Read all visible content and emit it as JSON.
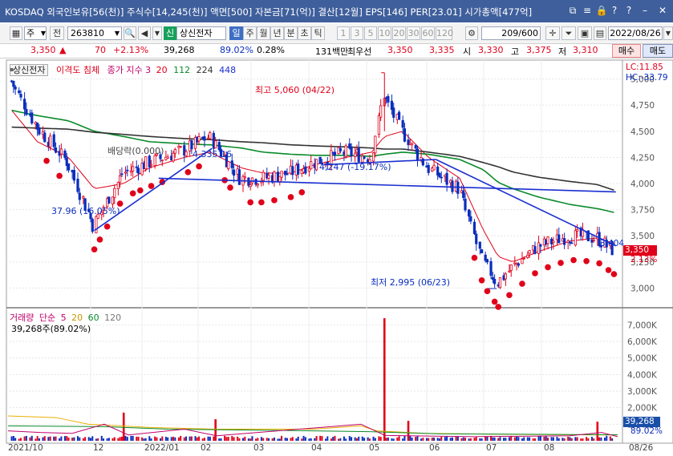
{
  "window": {
    "title": "KOSDAQ 외국인보유[56(천)] 주식수[14,245(천)] 액면[500] 자본금[71(억)] 결산[12월] EPS[146] PER[23.01] 시가총액[477억]",
    "icons": [
      "link-icon",
      "list-icon",
      "lock-icon",
      "help-icon",
      "minimize-icon",
      "close-icon"
    ]
  },
  "toolbar": {
    "market_option": "주",
    "previous_label": "전",
    "stock_code": "263810",
    "stock_name_prefix": "신",
    "stock_name": "상신전자",
    "periods": [
      "일",
      "주",
      "월",
      "년",
      "분",
      "초",
      "틱"
    ],
    "selected_period": "일",
    "minute_intervals": [
      "1",
      "3",
      "5",
      "10",
      "20",
      "30",
      "60",
      "120"
    ],
    "count": "209",
    "count_total": "/600",
    "date": "2022/08/26"
  },
  "quote": {
    "price": "3,350",
    "change": "70",
    "change_pct": "+2.13%",
    "volume": "39,268",
    "volume_ratio": "89.02%",
    "turnover": "0.28%",
    "trade_amount": "131백만",
    "priority_label": "최우선",
    "ask_price": "3,350",
    "bid_price": "3,335",
    "open_label": "시",
    "open": "3,330",
    "high_label": "고",
    "high": "3,375",
    "low_label": "저",
    "low": "3,310",
    "buy_label": "매수",
    "sell_label": "매도"
  },
  "price_legend": {
    "name": "상신전자",
    "indicator": "이격도 침체",
    "ma_label": "종가 지수 3",
    "ma1": "20",
    "ma2": "112",
    "ma3": "224",
    "ma4": "448"
  },
  "volume_legend": {
    "label": "거래량",
    "ma_label": "단순",
    "ma1": "5",
    "ma2": "20",
    "ma3": "60",
    "ma4": "120",
    "current": "39,268주(89.02%)"
  },
  "axis_tags": {
    "lc": "LC:11.85",
    "hc": "HC:-33.79",
    "price_tag": "3,350",
    "change_tag": "2.13%",
    "volume_tag": "39,268",
    "volume_pct_tag": "89.02%",
    "trend_tag": "3,404"
  },
  "annotations": {
    "high": "최고 5,060 (04/22)",
    "low": "최저 2,995 (06/23)",
    "left": "37.96 (16.05%)",
    "dividend": "배당락(0.000)",
    "trend1": "4,335.16",
    "trend2": "4,247 (-19.17%)"
  },
  "chart_data": [
    {
      "type": "line",
      "subtype": "candlestick",
      "title": "상신전자",
      "y_ticks": [
        "5,000",
        "4,750",
        "4,500",
        "4,250",
        "4,000",
        "3,750",
        "3,500",
        "3,250",
        "3,000"
      ],
      "ylim": [
        2850,
        5150
      ],
      "x_labels": [
        "2021/10",
        "12",
        "2022/01",
        "02",
        "03",
        "04",
        "05",
        "06",
        "07",
        "08",
        "08/26"
      ],
      "series": [
        {
          "name": "종가",
          "x": [
            "2021/10/01",
            "2021/10/15",
            "2021/11/01",
            "2021/11/15",
            "2021/12/01",
            "2021/12/15",
            "2022/01/03",
            "2022/01/17",
            "2022/02/03",
            "2022/02/15",
            "2022/03/02",
            "2022/03/15",
            "2022/04/01",
            "2022/04/15",
            "2022/04/22",
            "2022/05/02",
            "2022/05/16",
            "2022/06/02",
            "2022/06/15",
            "2022/06/23",
            "2022/07/01",
            "2022/07/15",
            "2022/08/01",
            "2022/08/16",
            "2022/08/26"
          ],
          "values": [
            4980,
            4550,
            4200,
            3600,
            4100,
            4200,
            4320,
            4450,
            4050,
            4050,
            4100,
            4200,
            4300,
            4250,
            4850,
            4500,
            4150,
            3950,
            3250,
            3050,
            3200,
            3400,
            3500,
            3480,
            3350
          ]
        },
        {
          "name": "MA 20",
          "values": [
            4700,
            4400,
            4250,
            3950,
            4000,
            4150,
            4250,
            4300,
            4150,
            4100,
            4100,
            4180,
            4250,
            4300,
            4450,
            4500,
            4250,
            4050,
            3550,
            3300,
            3250,
            3350,
            3450,
            3480,
            3420
          ]
        },
        {
          "name": "MA 112",
          "values": [
            4700,
            4650,
            4600,
            4500,
            4450,
            4400,
            4380,
            4370,
            4340,
            4300,
            4280,
            4270,
            4270,
            4260,
            4280,
            4300,
            4280,
            4230,
            4130,
            4010,
            3950,
            3870,
            3800,
            3760,
            3720
          ]
        },
        {
          "name": "MA 224",
          "values": [
            4540,
            4530,
            4520,
            4490,
            4470,
            4450,
            4430,
            4420,
            4400,
            4390,
            4370,
            4360,
            4350,
            4340,
            4330,
            4330,
            4300,
            4260,
            4200,
            4160,
            4110,
            4060,
            4020,
            3990,
            3930
          ]
        }
      ]
    },
    {
      "type": "bar",
      "title": "거래량",
      "y_ticks": [
        "7,000K",
        "6,000K",
        "5,000K",
        "4,000K",
        "3,000K",
        "2,000K",
        "1,000K"
      ],
      "ylim": [
        0,
        7500
      ],
      "series": [
        {
          "name": "거래량",
          "x": [
            "2021/10/01",
            "2021/11/08",
            "2021/12/01",
            "2021/12/20",
            "2022/01/20",
            "2022/03/15",
            "2022/04/22",
            "2022/05/05",
            "2022/06/10",
            "2022/06/23",
            "2022/07/10",
            "2022/08/16",
            "2022/08/26"
          ],
          "values": [
            300,
            250,
            1700,
            200,
            1300,
            150,
            7400,
            1200,
            500,
            600,
            350,
            1150,
            39
          ]
        }
      ]
    }
  ],
  "colors": {
    "title_bar": "#3f5f9c",
    "up": "#e0001a",
    "down": "#0a2dbd",
    "ma20": "#e0001a",
    "ma112": "#0a8a2a",
    "ma224": "#333333",
    "trendline": "#1a2fd0",
    "oversold_marker": "#e0001a"
  }
}
